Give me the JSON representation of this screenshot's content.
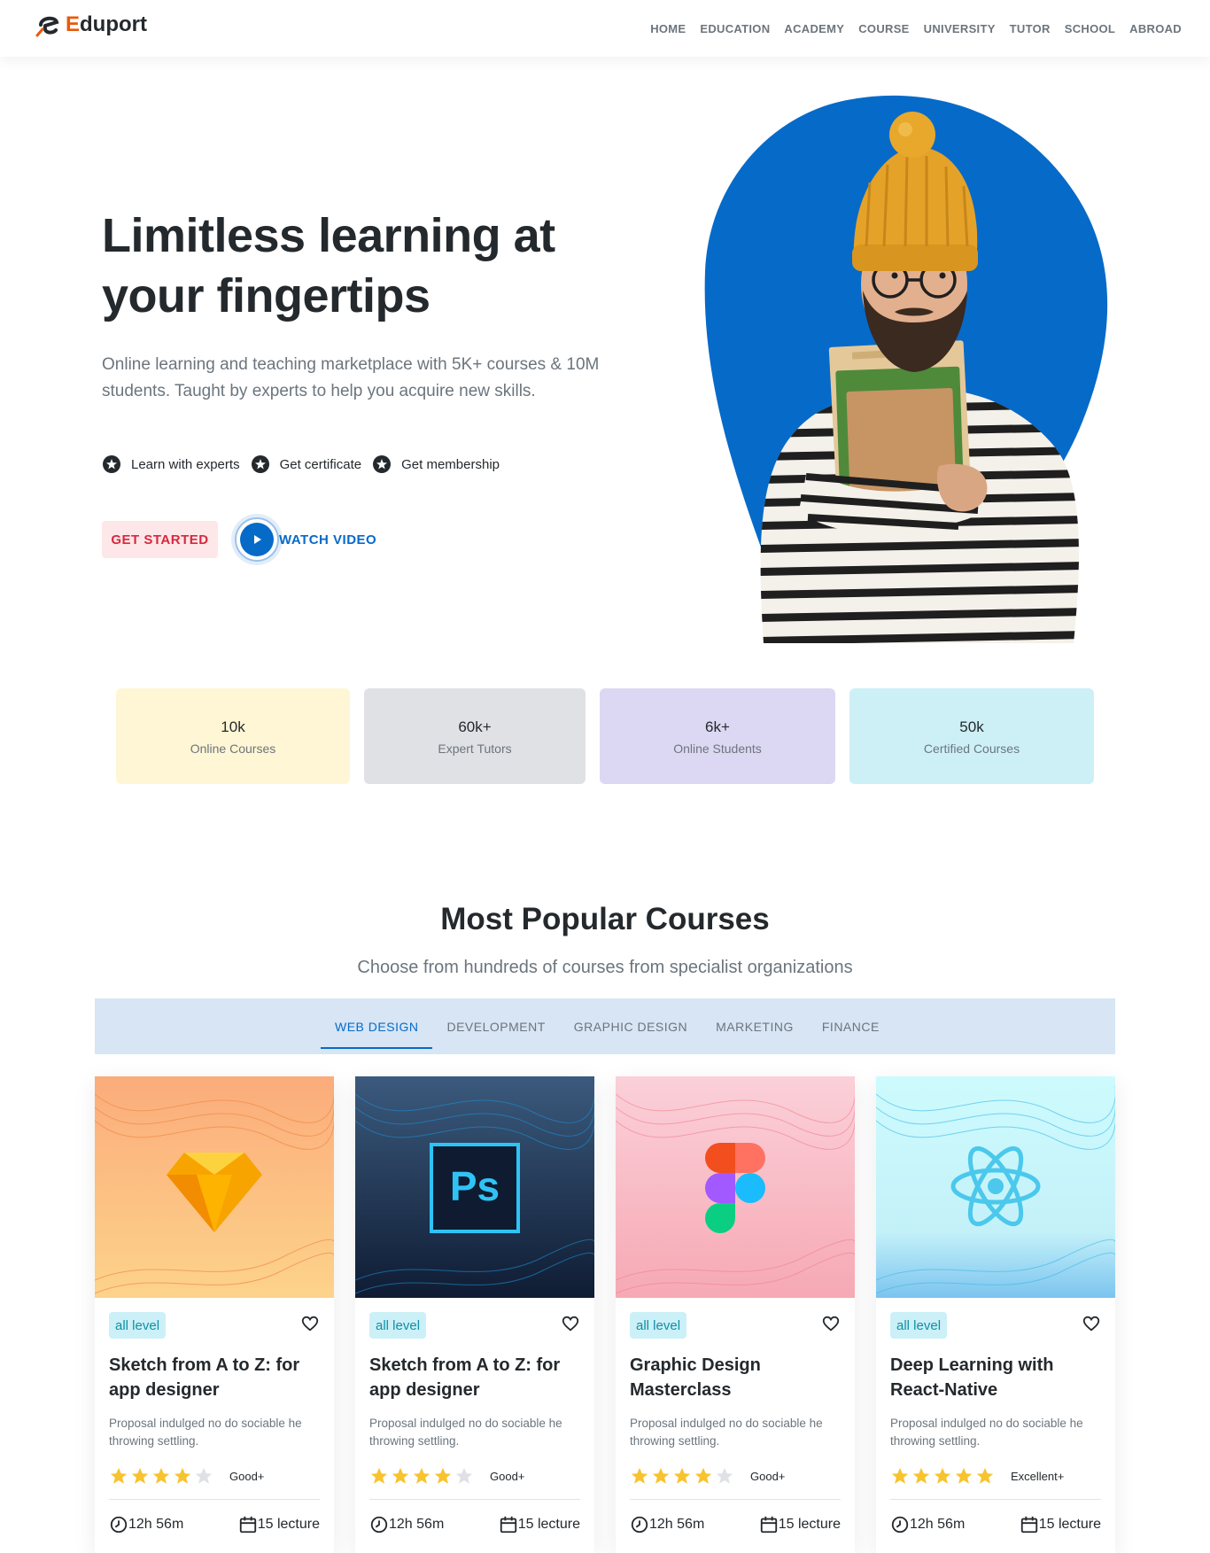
{
  "brand": {
    "name_first": "E",
    "name_rest": "duport",
    "accent": "#e8590c"
  },
  "nav": [
    "HOME",
    "EDUCATION",
    "ACADEMY",
    "COURSE",
    "UNIVERSITY",
    "TUTOR",
    "SCHOOL",
    "ABROAD"
  ],
  "hero": {
    "title": "Limitless learning at your fingertips",
    "description": "Online learning and teaching marketplace with 5K+ courses & 10M students. Taught by experts to help you acquire new skills.",
    "features": [
      "Learn with experts",
      "Get certificate",
      "Get membership"
    ],
    "cta_primary": "GET STARTED",
    "cta_secondary": "WATCH VIDEO",
    "blob_color": "#066ac9"
  },
  "counters": [
    {
      "value": "10k",
      "label": "Online Courses",
      "bg": "#fef6d4"
    },
    {
      "value": "60k+",
      "label": "Expert Tutors",
      "bg": "#dfe1e5"
    },
    {
      "value": "6k+",
      "label": "Online Students",
      "bg": "#dcd8f3"
    },
    {
      "value": "50k",
      "label": "Certified Courses",
      "bg": "#cdf0f7"
    }
  ],
  "section": {
    "title": "Most Popular Courses",
    "subtitle": "Choose from hundreds of courses from specialist organizations"
  },
  "tabs": [
    {
      "label": "WEB DESIGN",
      "active": true
    },
    {
      "label": "DEVELOPMENT",
      "active": false
    },
    {
      "label": "GRAPHIC DESIGN",
      "active": false
    },
    {
      "label": "MARKETING",
      "active": false
    },
    {
      "label": "FINANCE",
      "active": false
    }
  ],
  "courses": [
    {
      "icon": "sketch-icon",
      "level": "all level",
      "title": "Sketch from A to Z: for app designer",
      "description": "Proposal indulged no do sociable he throwing settling.",
      "rating": 4,
      "rating_label": "Good+",
      "duration": "12h 56m",
      "lectures": "15 lecture",
      "theme": "orange"
    },
    {
      "icon": "photoshop-icon",
      "level": "all level",
      "title": "Sketch from A to Z: for app designer",
      "description": "Proposal indulged no do sociable he throwing settling.",
      "rating": 4,
      "rating_label": "Good+",
      "duration": "12h 56m",
      "lectures": "15 lecture",
      "theme": "navy"
    },
    {
      "icon": "figma-icon",
      "level": "all level",
      "title": "Graphic Design Masterclass",
      "description": "Proposal indulged no do sociable he throwing settling.",
      "rating": 4,
      "rating_label": "Good+",
      "duration": "12h 56m",
      "lectures": "15 lecture",
      "theme": "pink"
    },
    {
      "icon": "react-icon",
      "level": "all level",
      "title": "Deep Learning with React-Native",
      "description": "Proposal indulged no do sociable he throwing settling.",
      "rating": 5,
      "rating_label": "Excellent+",
      "duration": "12h 56m",
      "lectures": "15 lecture",
      "theme": "cyan"
    }
  ]
}
